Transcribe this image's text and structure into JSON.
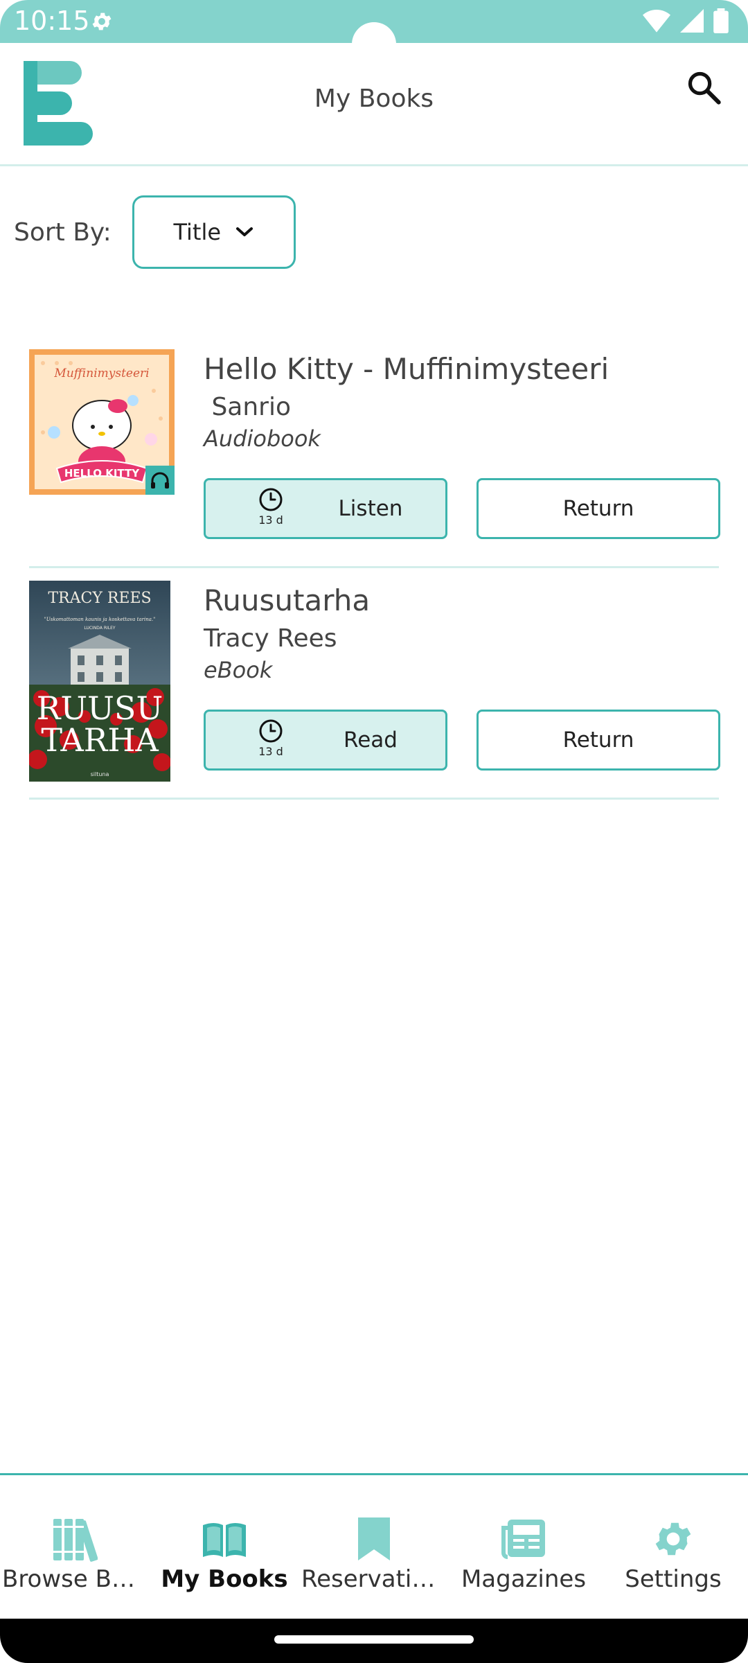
{
  "status_bar": {
    "time": "10:15"
  },
  "header": {
    "title": "My Books"
  },
  "sort": {
    "label": "Sort By:",
    "selected": "Title"
  },
  "books": [
    {
      "title": "Hello Kitty - Muffinimysteeri",
      "author": " Sanrio",
      "format": "Audiobook",
      "cover_text_top": "Muffinimysteeri",
      "cover_text_banner": "HELLO KITTY",
      "days_left": "13 d",
      "primary_action": "Listen",
      "secondary_action": "Return"
    },
    {
      "title": "Ruusutarha",
      "author": "Tracy Rees",
      "format": "eBook",
      "cover_author": "TRACY REES",
      "cover_title_1": "RUUSU",
      "cover_title_2": "TARHA",
      "cover_quote": "\"Uskomattoman kaunis ja koskettava tarina.\"",
      "cover_quote_by": "LUCINDA RILEY",
      "cover_publisher": "siltuna",
      "days_left": "13 d",
      "primary_action": "Read",
      "secondary_action": "Return"
    }
  ],
  "nav": {
    "items": [
      {
        "label": "Browse Bo..."
      },
      {
        "label": "My Books"
      },
      {
        "label": "Reservations"
      },
      {
        "label": "Magazines"
      },
      {
        "label": "Settings"
      }
    ]
  },
  "colors": {
    "accent": "#3cb4ad",
    "status_bar": "#84d3cc",
    "button_fill": "#d7f1ee",
    "divider": "#d3eeeb"
  }
}
